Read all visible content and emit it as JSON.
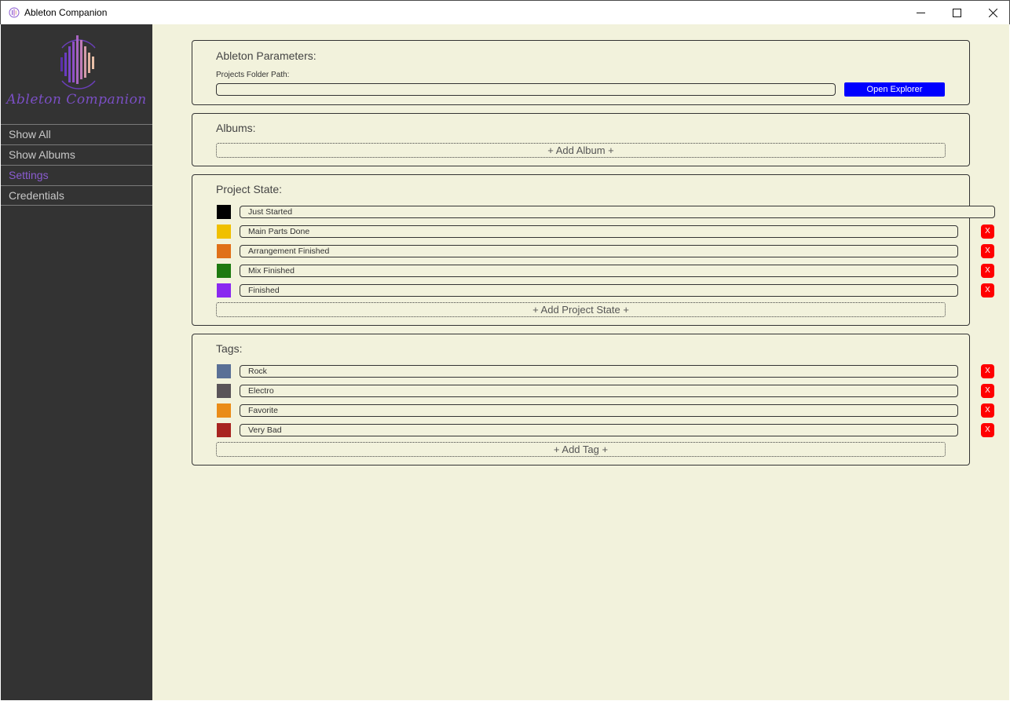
{
  "window": {
    "title": "Ableton Companion"
  },
  "sidebar": {
    "logo_text": "Ableton Companion",
    "items": [
      {
        "label": "Show All",
        "active": false
      },
      {
        "label": "Show Albums",
        "active": false
      },
      {
        "label": "Settings",
        "active": true
      },
      {
        "label": "Credentials",
        "active": false
      }
    ]
  },
  "ableton_params": {
    "title": "Ableton Parameters:",
    "folder_label": "Projects Folder Path:",
    "folder_value": "",
    "open_button": "Open Explorer"
  },
  "albums": {
    "title": "Albums:",
    "add_button": "+ Add Album +"
  },
  "project_state": {
    "title": "Project State:",
    "items": [
      {
        "label": "Just Started",
        "color": "#000000",
        "deletable": false
      },
      {
        "label": "Main Parts Done",
        "color": "#f0c000",
        "deletable": true
      },
      {
        "label": "Arrangement Finished",
        "color": "#e07018",
        "deletable": true
      },
      {
        "label": "Mix Finished",
        "color": "#1e7a10",
        "deletable": true
      },
      {
        "label": "Finished",
        "color": "#8a28f0",
        "deletable": true
      }
    ],
    "add_button": "+ Add Project State +",
    "delete_label": "X"
  },
  "tags": {
    "title": "Tags:",
    "items": [
      {
        "label": "Rock",
        "color": "#5a7096"
      },
      {
        "label": "Electro",
        "color": "#5a5458"
      },
      {
        "label": "Favorite",
        "color": "#ea8c18"
      },
      {
        "label": "Very Bad",
        "color": "#a82420"
      }
    ],
    "add_button": "+ Add Tag +",
    "delete_label": "X"
  },
  "colors": {
    "sidebar_bg": "#333333",
    "main_bg": "#f2f2dc",
    "accent": "#8a5cd0",
    "button_blue": "#0000ff",
    "delete_red": "#ff0000"
  }
}
